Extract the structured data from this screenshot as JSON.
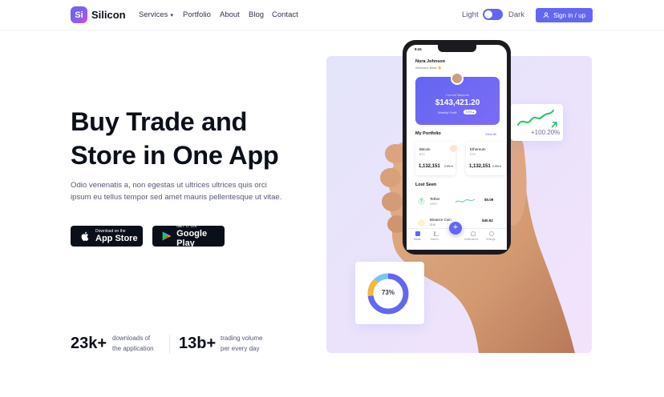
{
  "brand": {
    "mark": "Si",
    "name": "Silicon"
  },
  "nav": {
    "items": [
      {
        "label": "Services",
        "dropdown": true
      },
      {
        "label": "Portfolio"
      },
      {
        "label": "About"
      },
      {
        "label": "Blog"
      },
      {
        "label": "Contact"
      }
    ],
    "theme": {
      "light_label": "Light",
      "dark_label": "Dark",
      "mode": "dark"
    },
    "signin_label": "Sign in / up"
  },
  "hero": {
    "title_line1": "Buy Trade and",
    "title_line2": "Store in One App",
    "description": "Odio venenatis a, non egestas ut ultrices ultrices quis orci ipsum eu tellus tempor sed amet mauris pellentesque ut vitae.",
    "appstore": {
      "small": "Download on the",
      "big": "App Store"
    },
    "googleplay": {
      "small": "GET IT ON",
      "big": "Google Play"
    }
  },
  "stats": [
    {
      "value": "23k+",
      "label_line1": "downloads of",
      "label_line2": "the application"
    },
    {
      "value": "13b+",
      "label_line1": "trading volume",
      "label_line2": "per every day"
    }
  ],
  "growth_card": {
    "value": "+100.20%"
  },
  "donut_card": {
    "value": "73%",
    "fraction": 0.73
  },
  "phone": {
    "time": "9:41",
    "user_name": "Nora Johnson",
    "welcome": "Welcome Back 👋",
    "balance_label": "Current Balance",
    "balance_value": "$143,421.20",
    "profit_label": "Weekly Profit",
    "profit_badge": "2.9% ▴",
    "portfolio_title": "My Portfolio",
    "view_all": "View All",
    "assets": [
      {
        "name": "Bitcoin",
        "sub": "BTC",
        "value": "1,132,151",
        "chip": "2.9% ▾"
      },
      {
        "name": "Ethereum",
        "sub": "ETH",
        "value": "1,132,151",
        "chip": "2.9% ▾"
      }
    ],
    "last_seen_title": "Lost Seen",
    "rows": [
      {
        "name": "Tether",
        "sub": "USDT",
        "value": "$0.09"
      },
      {
        "name": "Binance Coin",
        "sub": "BNB",
        "value": "$40.52"
      }
    ],
    "tabs": [
      "Home",
      "Market",
      "Notifications",
      "Settings"
    ],
    "fab": "+"
  },
  "colors": {
    "primary": "#6366f1",
    "dark": "#0b0f19",
    "muted": "#565973",
    "green": "#22c55e",
    "orange": "#f59e0b",
    "sky": "#60a5fa"
  }
}
